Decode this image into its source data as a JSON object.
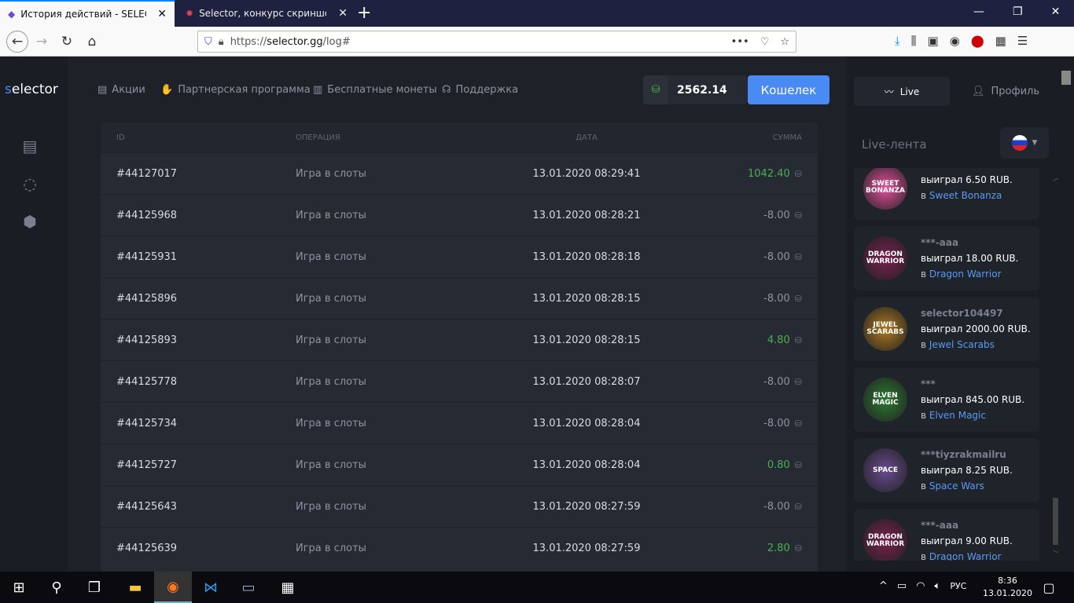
{
  "browser": {
    "tabs": [
      {
        "title": "История действий - SELECTOR",
        "active": true
      },
      {
        "title": "Selector, конкурс скриншотов",
        "active": false
      }
    ],
    "url_prefix": "https://",
    "url_domain": "selector.gg",
    "url_path": "/log#"
  },
  "site": {
    "logo_s": "s",
    "logo_rest": "elector",
    "nav": [
      {
        "label": "Акции",
        "icon": "list-icon"
      },
      {
        "label": "Партнерская программа",
        "icon": "handshake-icon"
      },
      {
        "label": "Бесплатные монеты",
        "icon": "gift-icon"
      },
      {
        "label": "Поддержка",
        "icon": "headset-icon"
      }
    ],
    "balance": "2562.14",
    "wallet_label": "Кошелек",
    "accent": "#4a8af4"
  },
  "table": {
    "headers": [
      "ID",
      "ОПЕРАЦИЯ",
      "ДАТА",
      "СУММА"
    ],
    "rows": [
      {
        "id": "#44127017",
        "op": "Игра в слоты",
        "date": "13.01.2020 08:29:41",
        "sum": "1042.40",
        "positive": true
      },
      {
        "id": "#44125968",
        "op": "Игра в слоты",
        "date": "13.01.2020 08:28:21",
        "sum": "-8.00",
        "positive": false
      },
      {
        "id": "#44125931",
        "op": "Игра в слоты",
        "date": "13.01.2020 08:28:18",
        "sum": "-8.00",
        "positive": false
      },
      {
        "id": "#44125896",
        "op": "Игра в слоты",
        "date": "13.01.2020 08:28:15",
        "sum": "-8.00",
        "positive": false
      },
      {
        "id": "#44125893",
        "op": "Игра в слоты",
        "date": "13.01.2020 08:28:15",
        "sum": "4.80",
        "positive": true
      },
      {
        "id": "#44125778",
        "op": "Игра в слоты",
        "date": "13.01.2020 08:28:07",
        "sum": "-8.00",
        "positive": false
      },
      {
        "id": "#44125734",
        "op": "Игра в слоты",
        "date": "13.01.2020 08:28:04",
        "sum": "-8.00",
        "positive": false
      },
      {
        "id": "#44125727",
        "op": "Игра в слоты",
        "date": "13.01.2020 08:28:04",
        "sum": "0.80",
        "positive": true
      },
      {
        "id": "#44125643",
        "op": "Игра в слоты",
        "date": "13.01.2020 08:27:59",
        "sum": "-8.00",
        "positive": false
      },
      {
        "id": "#44125639",
        "op": "Игра в слоты",
        "date": "13.01.2020 08:27:59",
        "sum": "2.80",
        "positive": true
      }
    ]
  },
  "right": {
    "live_label": "Live",
    "profile_label": "Профиль",
    "feed_title": "Live-лента",
    "feed": [
      {
        "user": "",
        "won": "выиграл 6.50 RUB.",
        "in": "в",
        "game": "Sweet Bonanza",
        "img": "SWEET BONANZA",
        "color": "#e84fa0"
      },
      {
        "user": "***-aaa",
        "won": "выиграл 18.00 RUB.",
        "in": "в",
        "game": "Dragon Warrior",
        "img": "DRAGON WARRIOR",
        "color": "#7a2050"
      },
      {
        "user": "selector104497",
        "won": "выиграл 2000.00 RUB.",
        "in": "в",
        "game": "Jewel Scarabs",
        "img": "JEWEL SCARABS",
        "color": "#b07a20"
      },
      {
        "user": "***",
        "won": "выиграл 845.00 RUB.",
        "in": "в",
        "game": "Elven Magic",
        "img": "ELVEN MAGIC",
        "color": "#2a7a30"
      },
      {
        "user": "***tiyzrakmailru",
        "won": "выиграл 8.25 RUB.",
        "in": "в",
        "game": "Space Wars",
        "img": "SPACE",
        "color": "#6a4a90"
      },
      {
        "user": "***-aaa",
        "won": "выиграл 9.00 RUB.",
        "in": "в",
        "game": "Dragon Warrior",
        "img": "DRAGON WARRIOR",
        "color": "#7a2050"
      }
    ]
  },
  "taskbar": {
    "lang": "РУС",
    "time": "8:36",
    "date": "13.01.2020"
  }
}
